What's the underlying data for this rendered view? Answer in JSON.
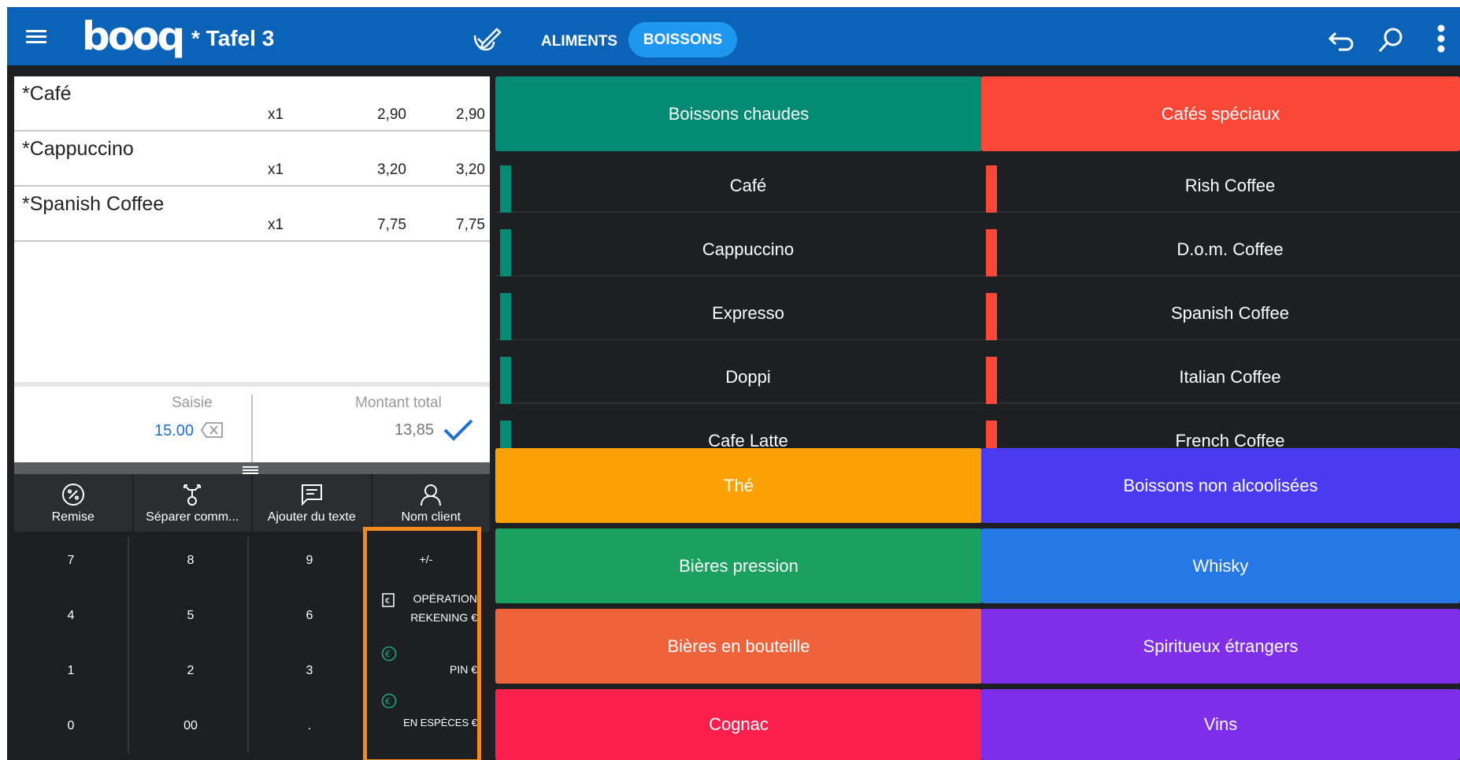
{
  "header": {
    "logo": "booq",
    "table_title": "* Tafel 3",
    "tabs": [
      {
        "label": "ALIMENTS",
        "active": false
      },
      {
        "label": "BOISSONS",
        "active": true
      }
    ],
    "icons": [
      "menu-icon",
      "edit-icon",
      "undo-icon",
      "search-icon",
      "more-icon"
    ]
  },
  "order": {
    "lines": [
      {
        "name": "*Café",
        "qty": "x1",
        "price": "2,90",
        "total": "2,90"
      },
      {
        "name": "*Cappuccino",
        "qty": "x1",
        "price": "3,20",
        "total": "3,20"
      },
      {
        "name": "*Spanish Coffee",
        "qty": "x1",
        "price": "7,75",
        "total": "7,75"
      }
    ]
  },
  "summary": {
    "saisie_label": "Saisie",
    "saisie_value": "15.00",
    "total_label": "Montant total",
    "total_value": "13,85"
  },
  "actions": [
    {
      "label": "Remise",
      "icon": "discount-icon"
    },
    {
      "label": "Séparer comm...",
      "icon": "split-icon"
    },
    {
      "label": "Ajouter du texte",
      "icon": "comment-icon"
    },
    {
      "label": "Nom client",
      "icon": "person-icon"
    }
  ],
  "keypad": {
    "keys": [
      "7",
      "8",
      "9",
      "4",
      "5",
      "6",
      "1",
      "2",
      "3",
      "0",
      "00",
      "."
    ]
  },
  "payment": {
    "plus_minus": "+/-",
    "operation_line1": "OPÉRATION",
    "operation_line2": "REKENING €",
    "pin": "PIN €",
    "cash": "EN ESPÈCES €"
  },
  "categories_left": {
    "header": {
      "label": "Boissons chaudes",
      "color": "#018b74"
    },
    "products": [
      "Café",
      "Cappuccino",
      "Expresso",
      "Doppi",
      "Cafe Latte"
    ],
    "bar_color": "#018b74"
  },
  "categories_right": {
    "header": {
      "label": "Cafés spéciaux",
      "color": "#f94837"
    },
    "products": [
      "Rish Coffee",
      "D.o.m. Coffee",
      "Spanish Coffee",
      "Italian Coffee",
      "French Coffee"
    ],
    "bar_color": "#f94837"
  },
  "category_grid": [
    {
      "label": "Thé",
      "color": "#fca106"
    },
    {
      "label": "Boissons non alcoolisées",
      "color": "#4a3bf0"
    },
    {
      "label": "Bières pression",
      "color": "#1aa15f"
    },
    {
      "label": "Whisky",
      "color": "#2679e4"
    },
    {
      "label": "Bières en bouteille",
      "color": "#ee623c"
    },
    {
      "label": "Spiritueux étrangers",
      "color": "#7f2fe8"
    },
    {
      "label": "Cognac",
      "color": "#fb1f4d"
    },
    {
      "label": "Vins",
      "color": "#7d2ee9"
    }
  ]
}
